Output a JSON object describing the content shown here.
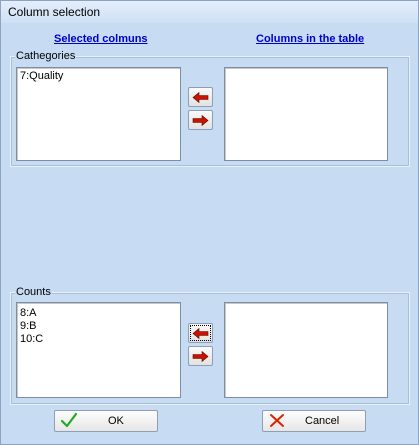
{
  "window": {
    "title": "Column selection"
  },
  "headers": {
    "left": "Selected colmuns",
    "right": "Columns in the table"
  },
  "categories": {
    "label": "Cathegories",
    "selected_items": [
      "7:Quality"
    ],
    "table_items": []
  },
  "counts": {
    "label": "Counts",
    "selected_items": [
      "8:A",
      "9:B",
      "10:C"
    ],
    "table_items": []
  },
  "buttons": {
    "ok": "OK",
    "cancel": "Cancel"
  },
  "icons": {
    "move_left": "arrow-left-icon",
    "move_right": "arrow-right-icon",
    "ok": "checkmark-icon",
    "cancel": "cross-icon"
  },
  "colors": {
    "arrow": "#cc1100",
    "check": "#22aa22",
    "cross": "#dd2200",
    "link": "#0000cc"
  }
}
